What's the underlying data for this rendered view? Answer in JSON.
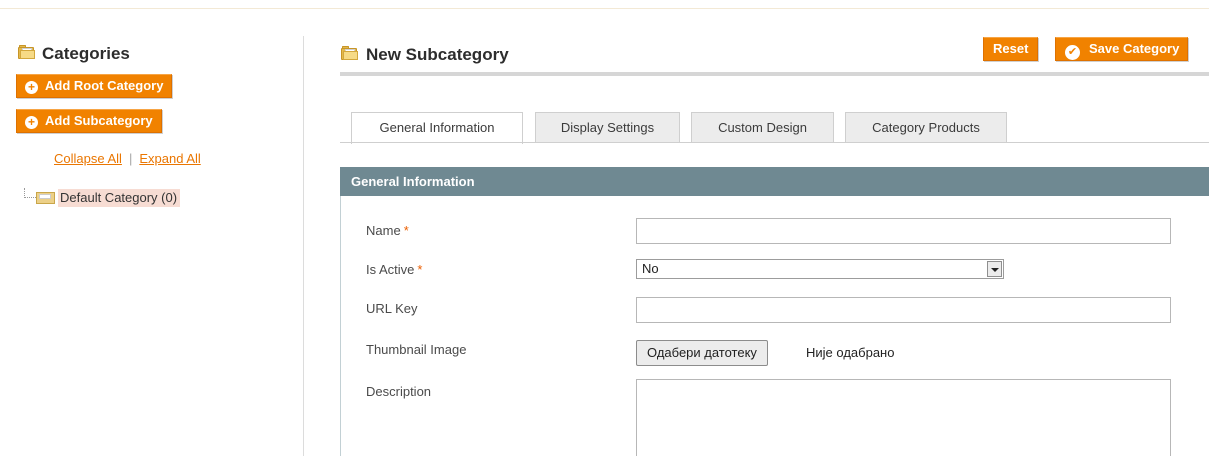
{
  "sidebar": {
    "title": "Categories",
    "add_root_label": "Add Root Category",
    "add_sub_label": "Add Subcategory",
    "collapse_all": "Collapse All",
    "separator": "|",
    "expand_all": "Expand All",
    "tree": [
      {
        "label": "Default Category (0)",
        "selected": true
      }
    ]
  },
  "header": {
    "title": "New Subcategory",
    "reset_label": "Reset",
    "save_label": "Save Category"
  },
  "tabs": [
    {
      "label": "General Information",
      "active": true
    },
    {
      "label": "Display Settings",
      "active": false
    },
    {
      "label": "Custom Design",
      "active": false
    },
    {
      "label": "Category Products",
      "active": false
    }
  ],
  "form": {
    "section_title": "General Information",
    "required_mark": "*",
    "fields": {
      "name": {
        "label": "Name",
        "required": true,
        "value": ""
      },
      "is_active": {
        "label": "Is Active",
        "required": true,
        "selected": "No"
      },
      "url_key": {
        "label": "URL Key",
        "required": false,
        "value": ""
      },
      "thumbnail": {
        "label": "Thumbnail Image",
        "button_label": "Одабери датотеку",
        "status": "Није одабрано"
      },
      "description": {
        "label": "Description",
        "value": ""
      }
    }
  },
  "colors": {
    "accent": "#f18200",
    "section_header": "#6f8992",
    "selected_node": "#f7dcd3",
    "link": "#ea7601",
    "required": "#eb5e00"
  },
  "icons": {
    "title_icon": "folder-icon",
    "add_icon": "plus-circle-icon",
    "save_icon": "check-circle-icon",
    "tree_icon": "folder-open-icon"
  }
}
